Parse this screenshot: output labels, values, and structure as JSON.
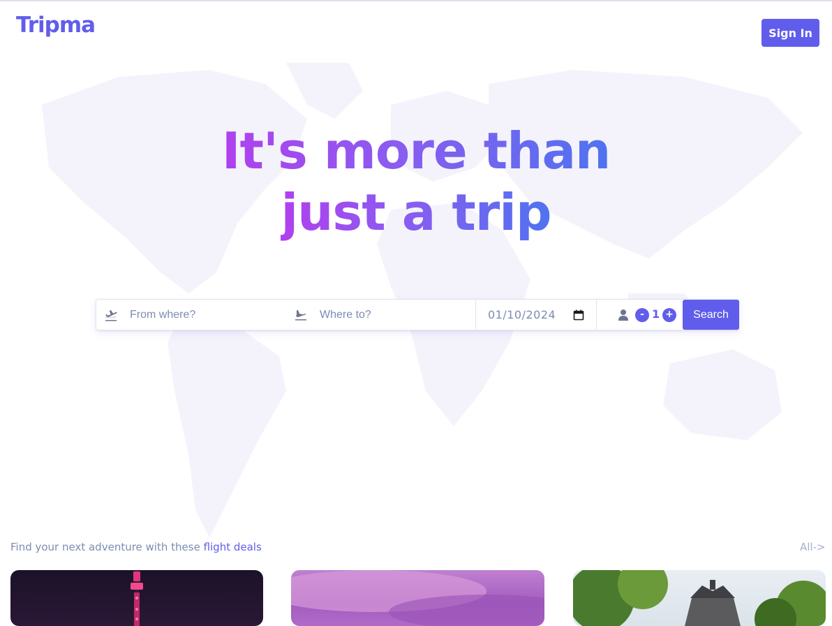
{
  "header": {
    "logo": "Tripma",
    "sign_in_label": "Sign In"
  },
  "hero": {
    "line1": "It's more than",
    "line2": "just a trip"
  },
  "search": {
    "from_placeholder": "From where?",
    "to_placeholder": "Where to?",
    "date_value": "01/10/2024",
    "passenger_count": "1",
    "decrement_label": "-",
    "increment_label": "+",
    "search_label": "Search"
  },
  "deals": {
    "prefix": "Find your next adventure with these ",
    "link": "flight deals",
    "all_label": "All->"
  },
  "colors": {
    "accent": "#605dec",
    "muted_text": "#7c8db0",
    "gradient_start": "#b040ee",
    "gradient_end": "#4f73f0"
  }
}
